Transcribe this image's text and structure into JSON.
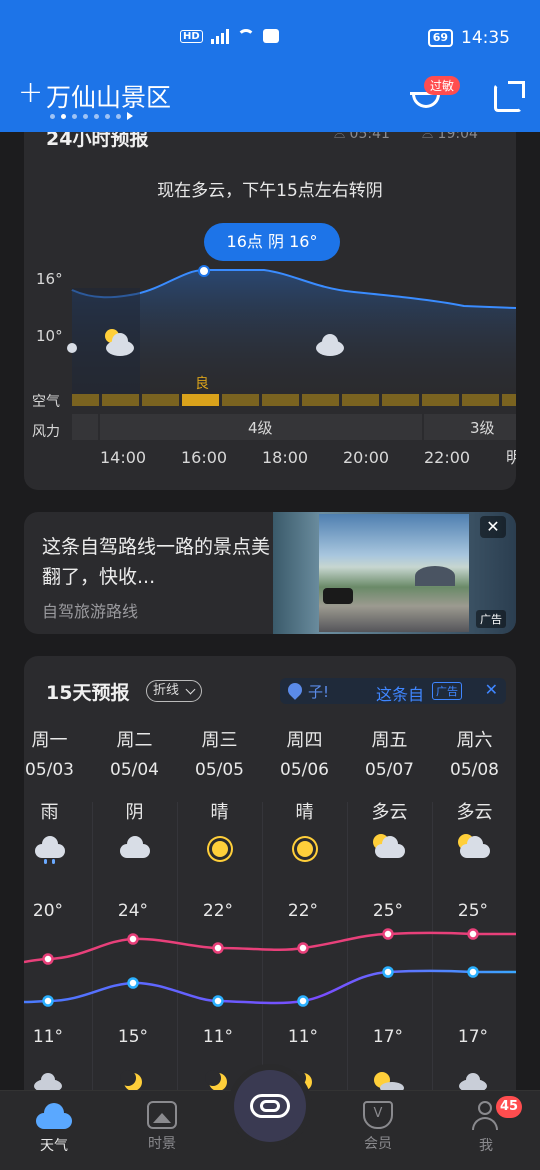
{
  "status": {
    "hd": "HD",
    "network": "4G",
    "battery": "69",
    "time": "14:35"
  },
  "header": {
    "add_label": "+",
    "city": "万仙山景区",
    "allergy_badge": "过敏"
  },
  "hourly": {
    "title": "24小时预报",
    "sunrise": "05:41",
    "sunset": "19:04",
    "summary": "现在多云，下午15点左右转阴",
    "bubble": "16点 阴 16°",
    "y_ticks": [
      "16°",
      "10°"
    ],
    "air_label": "空气",
    "air_quality_marker": "良",
    "wind_label": "风力",
    "wind_levels": [
      "4级",
      "3级"
    ],
    "times": [
      "14:00",
      "16:00",
      "18:00",
      "20:00",
      "22:00",
      "明"
    ]
  },
  "ad": {
    "headline": "这条自驾路线一路的景点美翻了，快收...",
    "source": "自驾旅游路线",
    "close": "✕",
    "tag": "广告"
  },
  "daily": {
    "title": "15天预报",
    "toggle_label": "折线",
    "ad_bar": {
      "text1": "子!",
      "text2": "这条自",
      "tag": "广告",
      "close": "✕"
    },
    "days": [
      {
        "weekday": "周一",
        "date": "05/03",
        "weather": "雨",
        "icon": "rain-icon",
        "high": "20°",
        "low": "11°"
      },
      {
        "weekday": "周二",
        "date": "05/04",
        "weather": "阴",
        "icon": "cloud-icon",
        "high": "24°",
        "low": "15°"
      },
      {
        "weekday": "周三",
        "date": "05/05",
        "weather": "晴",
        "icon": "sun-icon",
        "high": "22°",
        "low": "11°"
      },
      {
        "weekday": "周四",
        "date": "05/06",
        "weather": "晴",
        "icon": "sun-icon",
        "high": "22°",
        "low": "11°"
      },
      {
        "weekday": "周五",
        "date": "05/07",
        "weather": "多云",
        "icon": "partly-cloudy-icon",
        "high": "25°",
        "low": "17°"
      },
      {
        "weekday": "周六",
        "date": "05/08",
        "weather": "多云",
        "icon": "partly-cloudy-icon",
        "high": "25°",
        "low": "17°"
      }
    ]
  },
  "tabs": [
    {
      "label": "天气",
      "active": true
    },
    {
      "label": "时景",
      "active": false
    },
    {
      "label": "会员",
      "active": false
    },
    {
      "label": "我",
      "active": false
    }
  ],
  "me_badge": "45",
  "colors": {
    "accent": "#1d74e8",
    "high_line": "#e8407a",
    "low_line": "#4a7cff",
    "air_good": "#d9a21b"
  }
}
